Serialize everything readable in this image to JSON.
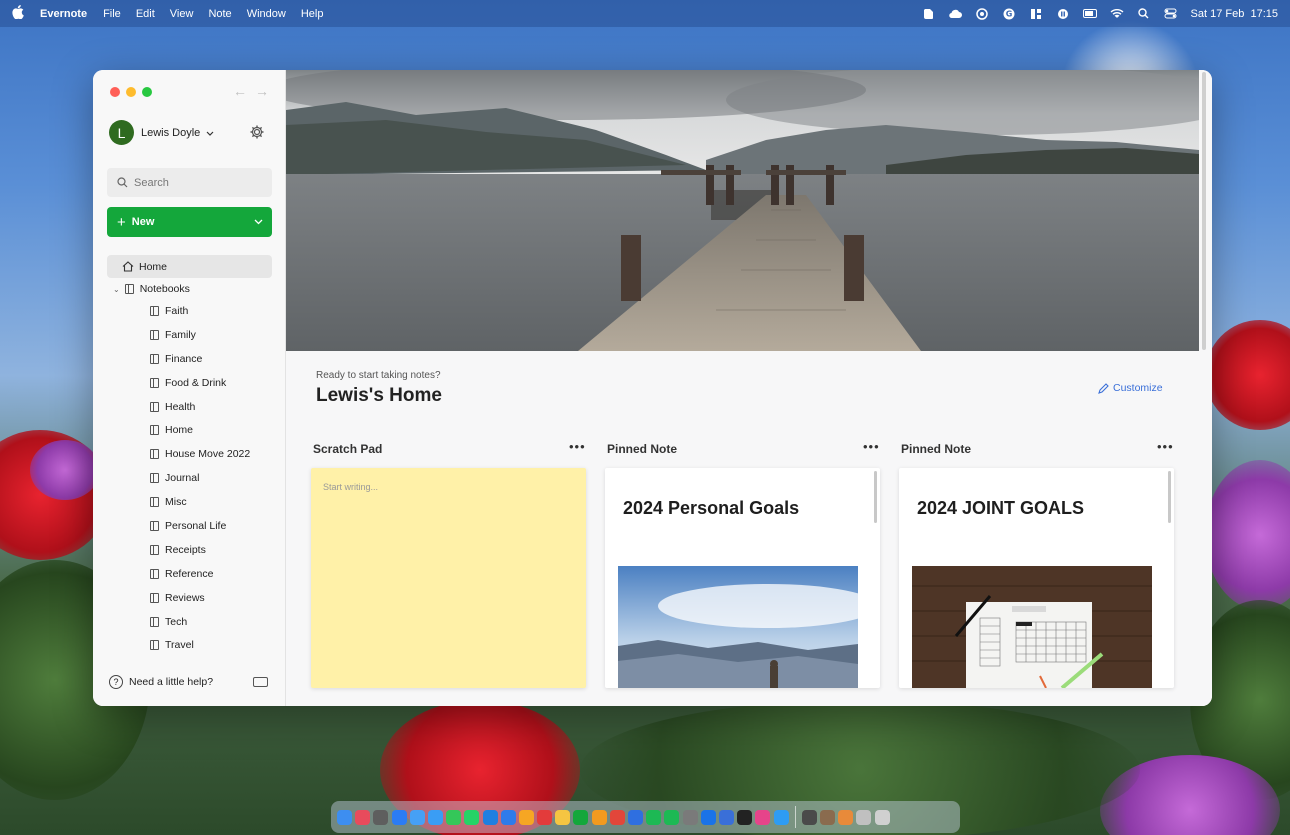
{
  "menubar": {
    "app_name": "Evernote",
    "menus": [
      "File",
      "Edit",
      "View",
      "Note",
      "Window",
      "Help"
    ],
    "datetime": "Sat 17 Feb  17:15"
  },
  "window": {
    "user": {
      "initial": "L",
      "name": "Lewis Doyle"
    },
    "search": {
      "placeholder": "Search"
    },
    "new_button": {
      "label": "New"
    },
    "nav": {
      "home_label": "Home",
      "notebooks_label": "Notebooks",
      "notebooks": [
        "Faith",
        "Family",
        "Finance",
        "Food & Drink",
        "Health",
        "Home",
        "House Move 2022",
        "Journal",
        "Misc",
        "Personal Life",
        "Receipts",
        "Reference",
        "Reviews",
        "Tech",
        "Travel"
      ]
    },
    "help_label": "Need a little help?",
    "home": {
      "subtitle": "Ready to start taking notes?",
      "title": "Lewis's Home",
      "customize_label": "Customize"
    },
    "cards": {
      "scratch": {
        "header": "Scratch Pad",
        "placeholder": "Start writing..."
      },
      "pinned1": {
        "header": "Pinned Note",
        "title": "2024 Personal Goals"
      },
      "pinned2": {
        "header": "Pinned Note",
        "title": "2024 JOINT GOALS"
      }
    }
  },
  "colors": {
    "accent_green": "#14a73b",
    "link_blue": "#3a6fd8",
    "scratch_yellow": "#fff1a8"
  },
  "dock": {
    "icon_colors": [
      "#3d8ef0",
      "#e84b5c",
      "#5e5e5e",
      "#2b7cf3",
      "#46a0f5",
      "#3a9df5",
      "#34c759",
      "#25d366",
      "#1f7fe0",
      "#2f7bea",
      "#f6a623",
      "#e33b3b",
      "#f5c542",
      "#14a73b",
      "#f29a1f",
      "#e2463a",
      "#2f6fe0",
      "#1db954",
      "#1db954",
      "#7a7a7a",
      "#1a73e8",
      "#3a6fd8",
      "#222222",
      "#e6448a",
      "#2e9cf3",
      "#4a4a4a",
      "#8a6b4e",
      "#e88a3a",
      "#c0c0c0",
      "#d0d0d0"
    ]
  }
}
